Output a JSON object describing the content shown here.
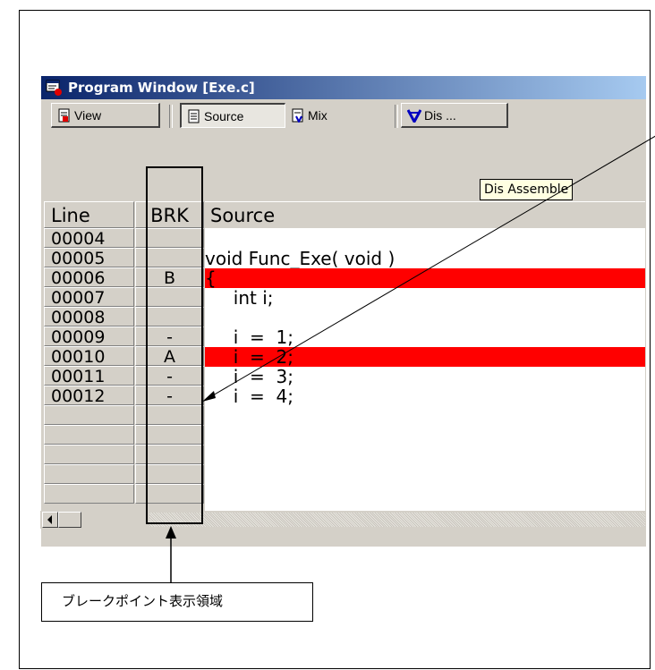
{
  "window": {
    "title": "Program Window [Exe.c]"
  },
  "toolbar": {
    "view_label": "View",
    "source_label": "Source",
    "mix_label": "Mix",
    "dis_label": "Dis ..."
  },
  "columns": {
    "line": "Line",
    "brk": "BRK",
    "source": "Source"
  },
  "tooltip": "Dis Assemble",
  "rows": [
    {
      "line": "00004",
      "brk": "",
      "source": "",
      "highlight": false
    },
    {
      "line": "00005",
      "brk": "",
      "source": "void Func_Exe( void )",
      "highlight": false
    },
    {
      "line": "00006",
      "brk": "B",
      "source": "{",
      "highlight": true
    },
    {
      "line": "00007",
      "brk": "",
      "source": "     int i;",
      "highlight": false
    },
    {
      "line": "00008",
      "brk": "",
      "source": "",
      "highlight": false
    },
    {
      "line": "00009",
      "brk": "-",
      "source": "     i  =  1;",
      "highlight": false
    },
    {
      "line": "00010",
      "brk": "A",
      "source": "     i  =  2;",
      "highlight": true
    },
    {
      "line": "00011",
      "brk": "-",
      "source": "     i  =  3;",
      "highlight": false
    },
    {
      "line": "00012",
      "brk": "-",
      "source": "     i  =  4;",
      "highlight": false
    }
  ],
  "callout": {
    "label": "ブレークポイント表示領域"
  },
  "colors": {
    "highlight": "#ff0000",
    "titlebar_start": "#0a246a",
    "titlebar_end": "#a6caf0",
    "face": "#d4d0c8"
  }
}
